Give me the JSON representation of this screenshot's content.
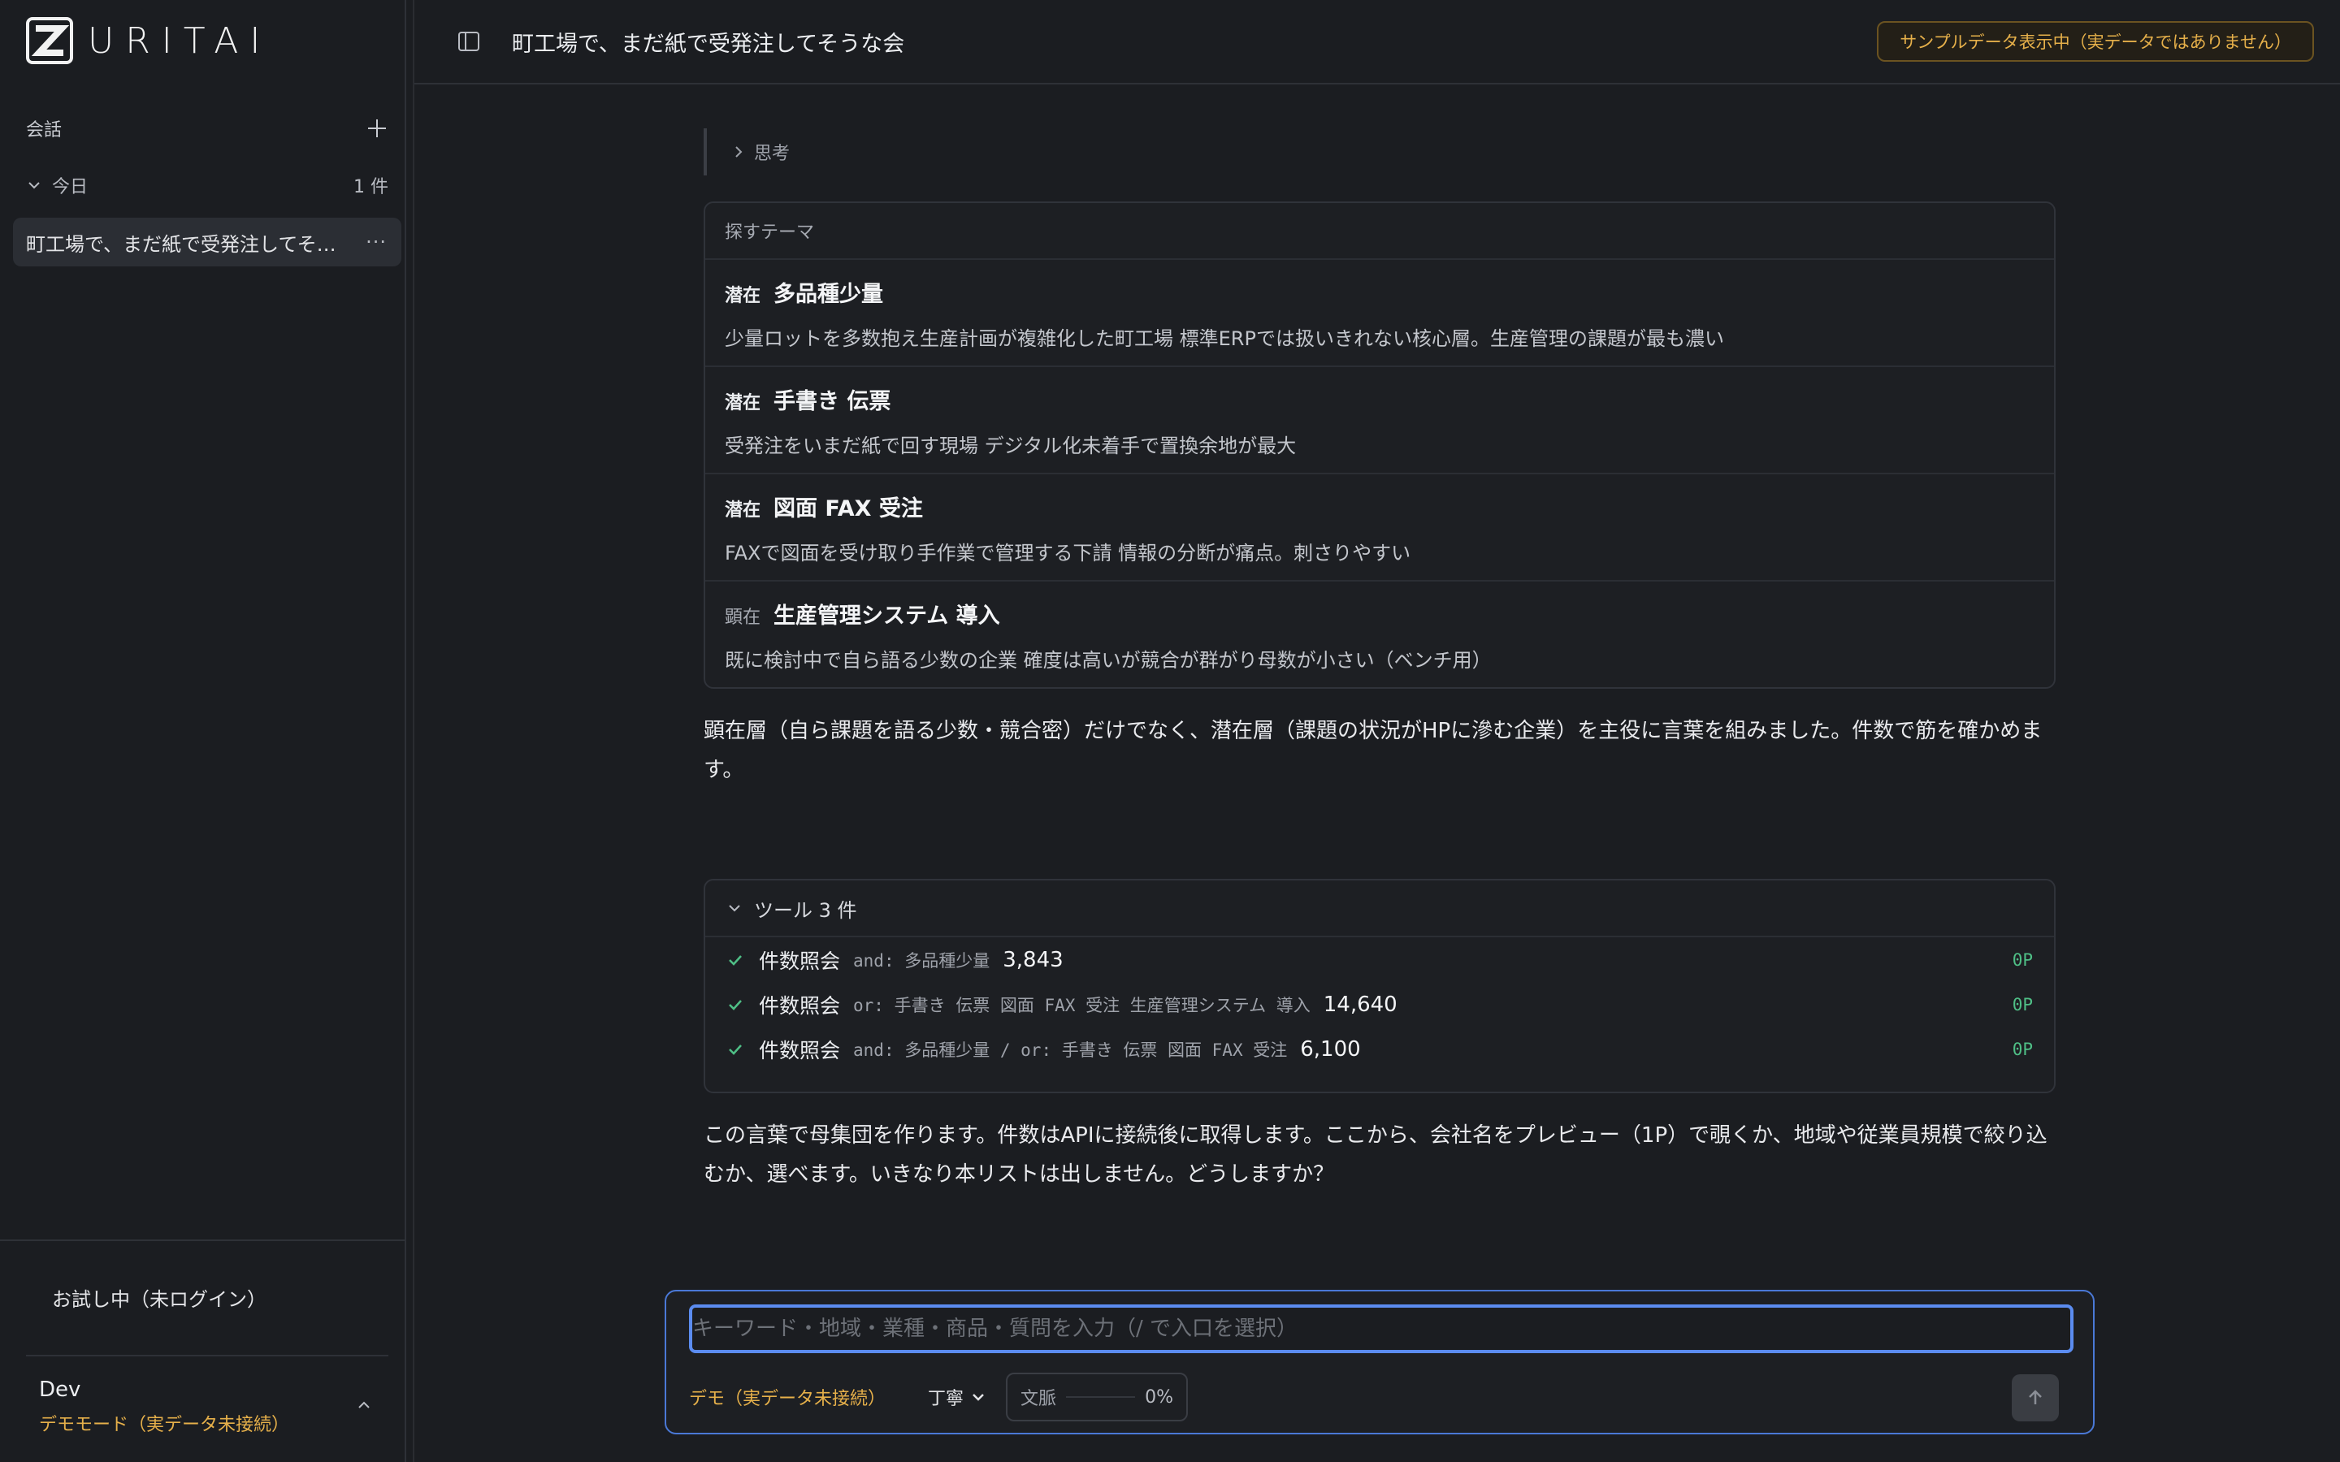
{
  "brand": {
    "name": "URITAI"
  },
  "sidebar": {
    "section_label": "会話",
    "group": {
      "label": "今日",
      "count": "1 件"
    },
    "conversations": [
      {
        "title": "町工場で、まだ紙で受発注してそうな会",
        "menu": "···"
      }
    ],
    "trial_status": "お試し中（未ログイン）",
    "user": {
      "name": "Dev",
      "mode": "デモモード（実データ未接続）"
    }
  },
  "header": {
    "title": "町工場で、まだ紙で受発注してそうな会",
    "badge": "サンプルデータ表示中（実データではありません）"
  },
  "thinking": {
    "label": "思考"
  },
  "themes": {
    "heading": "探すテーマ",
    "items": [
      {
        "tag": "潜在",
        "name": "多品種少量",
        "desc": "少量ロットを多数抱え生産計画が複雑化した町工場 標準ERPでは扱いきれない核心層。生産管理の課題が最も濃い"
      },
      {
        "tag": "潜在",
        "name": "手書き 伝票",
        "desc": "受発注をいまだ紙で回す現場 デジタル化未着手で置換余地が最大"
      },
      {
        "tag": "潜在",
        "name": "図面 FAX 受注",
        "desc": "FAXで図面を受け取り手作業で管理する下請 情報の分断が痛点。刺さりやすい"
      },
      {
        "tag": "顕在",
        "name": "生産管理システム 導入",
        "desc": "既に検討中で自ら語る少数の企業 確度は高いが競合が群がり母数が小さい（ベンチ用）"
      }
    ]
  },
  "message1": "顕在層（自ら課題を語る少数・競合密）だけでなく、潜在層（課題の状況がHPに滲む企業）を主役に言葉を組みました。件数で筋を確かめます。",
  "tools": {
    "heading": "ツール 3 件",
    "items": [
      {
        "name": "件数照会",
        "query": "and: 多品種少量",
        "count": "3,843",
        "pages": "0P"
      },
      {
        "name": "件数照会",
        "query": "or: 手書き 伝票 図面 FAX 受注 生産管理システム 導入",
        "count": "14,640",
        "pages": "0P"
      },
      {
        "name": "件数照会",
        "query": "and: 多品種少量 / or: 手書き 伝票 図面 FAX 受注",
        "count": "6,100",
        "pages": "0P"
      }
    ]
  },
  "message2": "この言葉で母集団を作ります。件数はAPIに接続後に取得します。ここから、会社名をプレビュー（1P）で覗くか、地域や従業員規模で絞り込むか、選べます。いきなり本リストは出しません。どうしますか？",
  "composer": {
    "placeholder": "キーワード・地域・業種・商品・質問を入力（/ で入口を選択）",
    "value": "",
    "demo_label": "デモ（実データ未接続）",
    "tone": "丁寧",
    "context_label": "文脈",
    "context_pct": "0%",
    "context_fraction": 0
  },
  "colors": {
    "accent": "#5b8cf0",
    "warning": "#e6b04a",
    "success": "#4fbf86",
    "background": "#1b1d21"
  }
}
